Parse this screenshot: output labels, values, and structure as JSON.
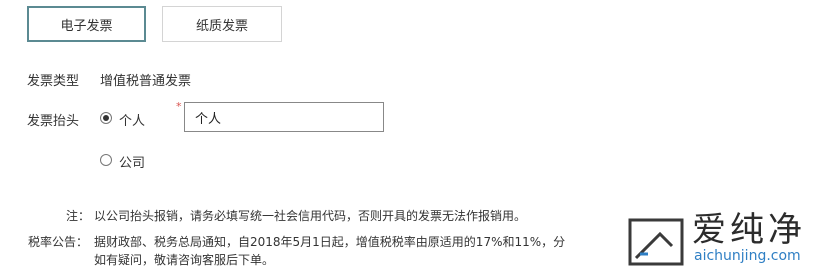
{
  "tabs": {
    "electronic": "电子发票",
    "paper": "纸质发票"
  },
  "invoice_type": {
    "label": "发票类型",
    "value": "增值税普通发票"
  },
  "invoice_header": {
    "label": "发票抬头",
    "option_personal": "个人",
    "option_company": "公司",
    "required_mark": "*",
    "name_value": "个人",
    "selected": "个人"
  },
  "notes": {
    "note_label": "注：",
    "note_text": "以公司抬头报销，请务必填写统一社会信用代码，否则开具的发票无法作报销用。",
    "tax_label": "税率公告：",
    "tax_line1": "据财政部、税务总局通知，自2018年5月1日起，增值税税率由原适用的17%和11%，分",
    "tax_line2": "如有疑问，敬请咨询客服后下单。"
  },
  "watermark": {
    "title": "爱纯净",
    "url": "aichunjing.com"
  }
}
